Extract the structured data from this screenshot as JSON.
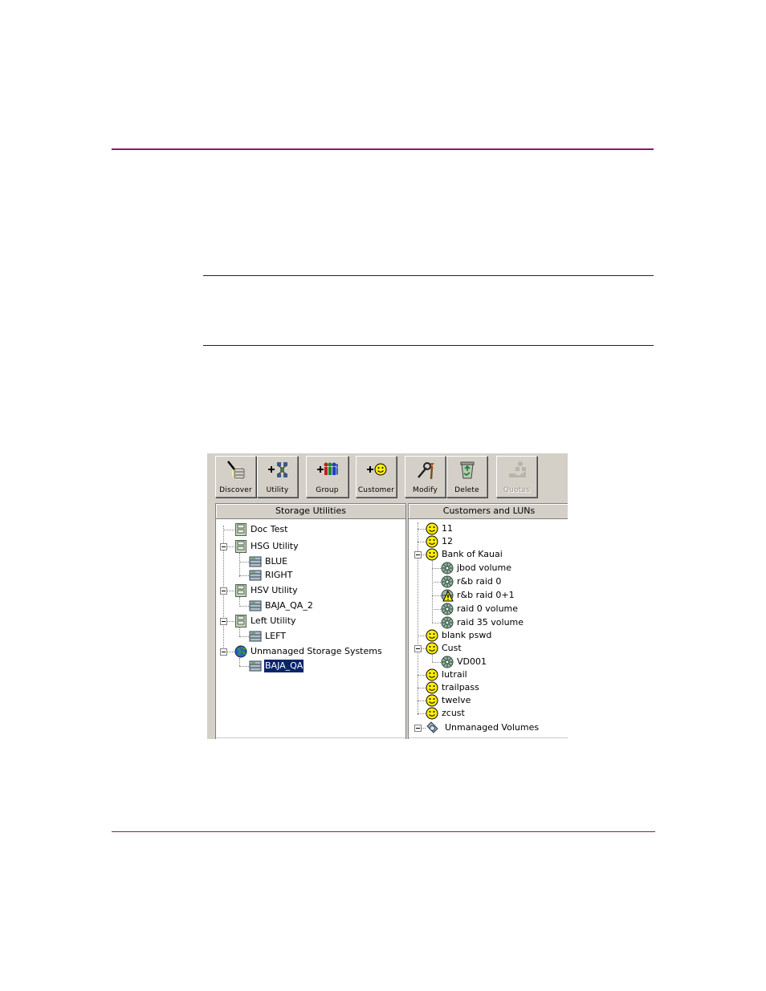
{
  "toolbar": {
    "buttons": [
      {
        "label": "Discover",
        "icon": "discover-icon"
      },
      {
        "label": "Utility",
        "icon": "add-utility-icon"
      },
      {
        "label": "Group",
        "icon": "add-group-icon"
      },
      {
        "label": "Customer",
        "icon": "add-customer-icon"
      },
      {
        "label": "Modify",
        "icon": "modify-icon"
      },
      {
        "label": "Delete",
        "icon": "delete-icon"
      },
      {
        "label": "Quotas",
        "icon": "quotas-icon",
        "disabled": true
      }
    ]
  },
  "left_pane": {
    "header": "Storage Utilities",
    "items": [
      {
        "label": "Doc Test",
        "icon": "utility-icon"
      },
      {
        "label": "HSG Utility",
        "icon": "utility-icon"
      },
      {
        "label": "BLUE",
        "icon": "storage-system-icon"
      },
      {
        "label": "RIGHT",
        "icon": "storage-system-icon"
      },
      {
        "label": "HSV Utility",
        "icon": "utility-icon"
      },
      {
        "label": "BAJA_QA_2",
        "icon": "storage-system-icon"
      },
      {
        "label": "Left Utility",
        "icon": "utility-icon"
      },
      {
        "label": "LEFT",
        "icon": "storage-system-icon"
      },
      {
        "label": "Unmanaged Storage Systems",
        "icon": "globe-icon"
      },
      {
        "label": "BAJA_QA",
        "icon": "storage-system-icon",
        "selected": true
      }
    ]
  },
  "right_pane": {
    "header": "Customers and LUNs",
    "items": [
      {
        "label": "11",
        "icon": "customer-icon"
      },
      {
        "label": "12",
        "icon": "customer-icon"
      },
      {
        "label": "Bank of Kauai",
        "icon": "customer-icon"
      },
      {
        "label": "jbod volume",
        "icon": "lun-icon"
      },
      {
        "label": "r&b raid 0",
        "icon": "lun-icon"
      },
      {
        "label": "r&b raid 0+1",
        "icon": "lun-warning-icon"
      },
      {
        "label": "raid 0 volume",
        "icon": "lun-icon"
      },
      {
        "label": "raid 35 volume",
        "icon": "lun-icon"
      },
      {
        "label": "blank pswd",
        "icon": "customer-icon"
      },
      {
        "label": "Cust",
        "icon": "customer-icon"
      },
      {
        "label": "VD001",
        "icon": "lun-icon"
      },
      {
        "label": "lutrail",
        "icon": "customer-icon"
      },
      {
        "label": "trailpass",
        "icon": "customer-icon"
      },
      {
        "label": "twelve",
        "icon": "customer-icon"
      },
      {
        "label": "zcust",
        "icon": "customer-icon"
      },
      {
        "label": "Unmanaged Volumes",
        "icon": "unmanaged-volumes-icon"
      }
    ]
  },
  "colors": {
    "rule": "#8a1a6e",
    "selection": "#0a246a",
    "window_face": "#d4d0c8"
  }
}
